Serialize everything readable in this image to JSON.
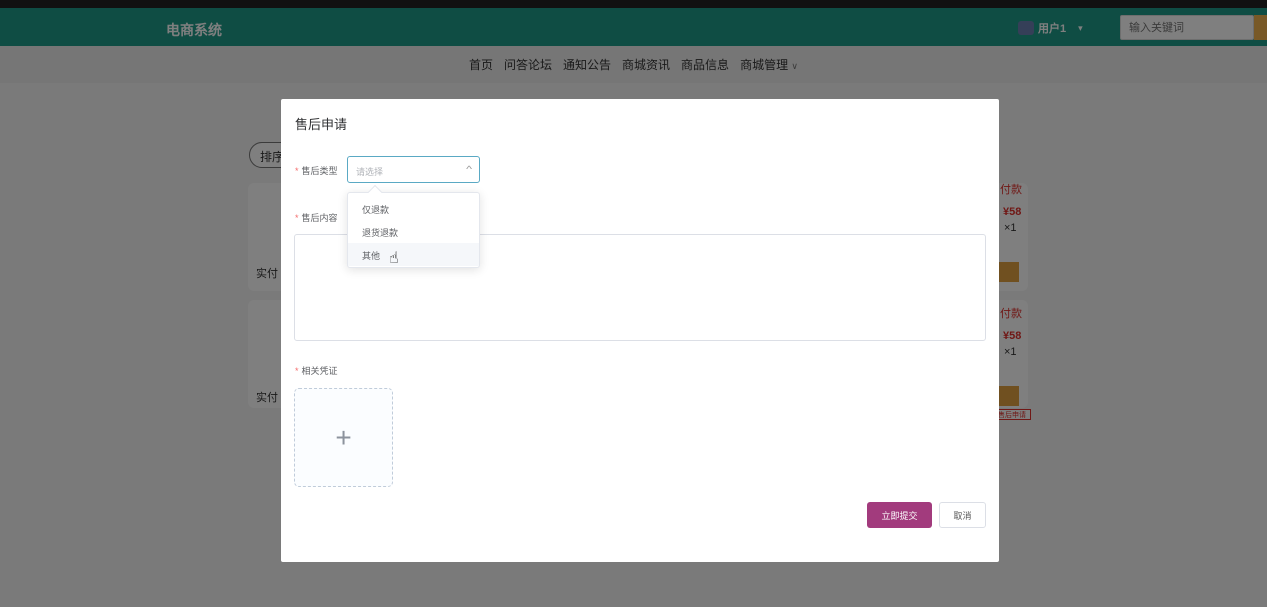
{
  "header": {
    "logo": "电商系统",
    "user": "用户1",
    "search_placeholder": "输入关键词"
  },
  "nav": {
    "items": [
      "首页",
      "问答论坛",
      "通知公告",
      "商城资讯",
      "商品信息",
      "商城管理"
    ],
    "dropdown_arrow": "∨"
  },
  "background": {
    "sort_label": "排序",
    "paid_prefix": "实付",
    "status": "付款",
    "price": "¥58",
    "qty": "×1",
    "after_sale_tag": "售后申请"
  },
  "dialog": {
    "title": "售后申请",
    "type_label": "售后类型",
    "type_placeholder": "请选择",
    "content_label": "售后内容",
    "proof_label": "相关凭证",
    "upload_plus": "+",
    "submit": "立即提交",
    "cancel": "取消"
  },
  "dropdown": {
    "options": [
      "仅退款",
      "退货退款",
      "其他"
    ],
    "hovered": "其他"
  },
  "colors": {
    "header": "#1e9a89",
    "submit": "#a23b7d",
    "price": "#e0302c"
  }
}
